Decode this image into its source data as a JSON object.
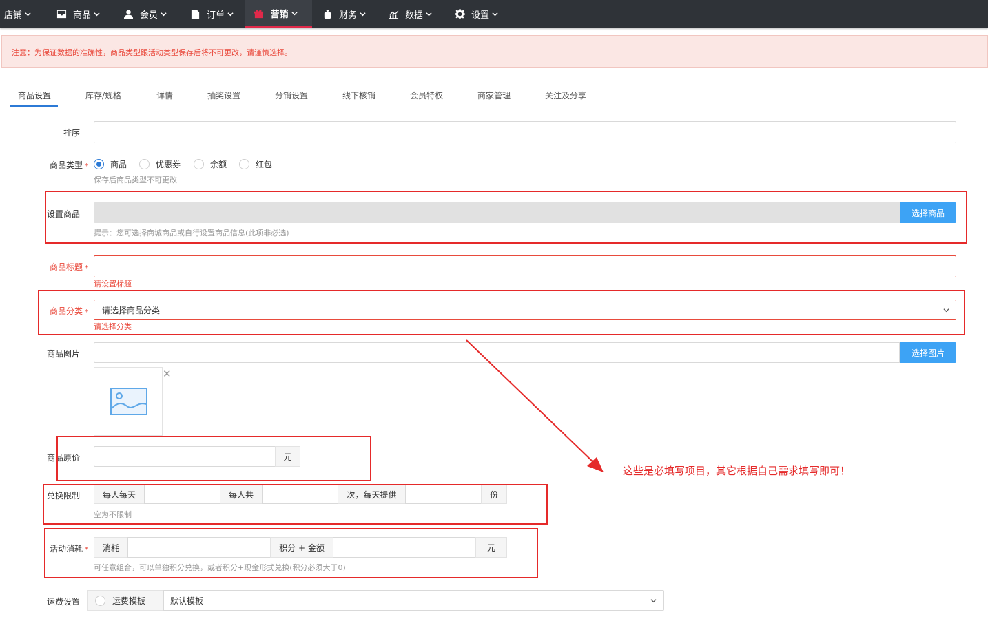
{
  "nav": {
    "items": [
      {
        "label": "店铺",
        "icon": "home-icon"
      },
      {
        "label": "商品",
        "icon": "inbox-icon"
      },
      {
        "label": "会员",
        "icon": "user-icon"
      },
      {
        "label": "订单",
        "icon": "file-icon"
      },
      {
        "label": "营销",
        "icon": "gift-icon"
      },
      {
        "label": "财务",
        "icon": "moneybag-icon"
      },
      {
        "label": "数据",
        "icon": "chart-icon"
      },
      {
        "label": "设置",
        "icon": "gear-icon"
      }
    ],
    "active": "营销"
  },
  "notice": "注意：为保证数据的准确性，商品类型跟活动类型保存后将不可更改，请谨慎选择。",
  "tabs": [
    "商品设置",
    "库存/规格",
    "详情",
    "抽奖设置",
    "分销设置",
    "线下核销",
    "会员特权",
    "商家管理",
    "关注及分享"
  ],
  "form": {
    "sort_label": "排序",
    "type_label": "商品类型",
    "type_options": [
      "商品",
      "优惠券",
      "余额",
      "红包"
    ],
    "type_help": "保存后商品类型不可更改",
    "set_goods_label": "设置商品",
    "set_goods_button": "选择商品",
    "set_goods_help": "提示：您可选择商城商品或自行设置商品信息(此项非必选)",
    "title_label": "商品标题",
    "title_error": "请设置标题",
    "category_label": "商品分类",
    "category_placeholder": "请选择商品分类",
    "category_error": "请选择分类",
    "image_label": "商品图片",
    "image_button": "选择图片",
    "price_label": "商品原价",
    "price_unit": "元",
    "limit_label": "兑换限制",
    "limit_per_day": "每人每天",
    "limit_per_total": "每人共",
    "limit_times_day": "次，每天提供",
    "limit_unit": "份",
    "limit_help": "空为不限制",
    "cost_label": "活动消耗",
    "cost_consume": "消耗",
    "cost_points_cash": "积分 + 金额",
    "cost_unit": "元",
    "cost_help": "可任意组合，可以单独积分兑换，或者积分+现金形式兑换(积分必须大于0)",
    "shipping_label": "运费设置",
    "shipping_template_option": "运费模板",
    "shipping_default": "默认模板"
  },
  "annotation": "这些是必填写项目，其它根据自己需求填写即可！",
  "colors": {
    "accent": "#2c7ad6",
    "error": "#e9473a",
    "annotation_red": "#e52a2a",
    "nav_bg": "#2f3338"
  }
}
